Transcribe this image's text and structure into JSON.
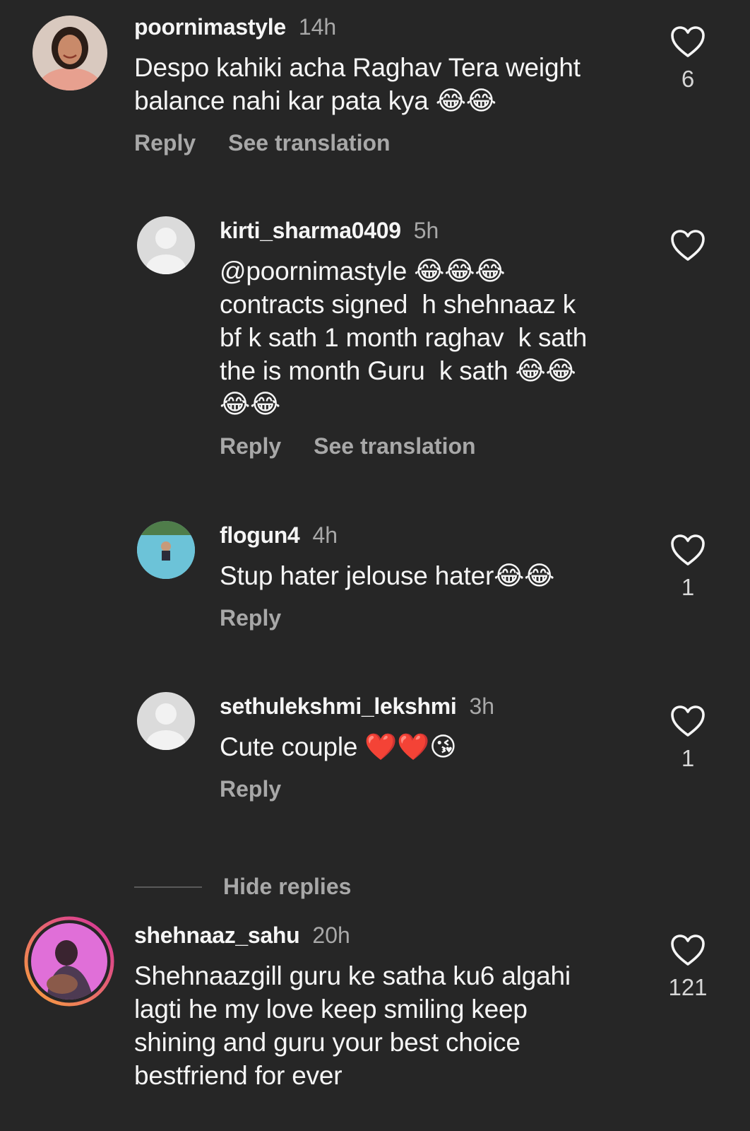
{
  "colors": {
    "background": "#262626",
    "primary_text": "#f5f5f5",
    "secondary_text": "#a8a8a8",
    "story_ring_start": "#f9a23a",
    "story_ring_end": "#d52f9e"
  },
  "icons": {
    "like": "heart-outline-icon"
  },
  "comments": [
    {
      "username": "poornimastyle",
      "time": "14h",
      "text": "Despo kahiki acha Raghav Tera weight\nbalance nahi kar pata kya 😂😂",
      "reply_label": "Reply",
      "translate_label": "See translation",
      "like_count": "6"
    },
    {
      "username": "kirti_sharma0409",
      "time": "5h",
      "text": "@poornimastyle 😂😂😂\ncontracts signed  h shehnaaz k\nbf k sath 1 month raghav  k sath\nthe is month Guru  k sath 😂😂\n😂😂",
      "reply_label": "Reply",
      "translate_label": "See translation",
      "like_count": ""
    },
    {
      "username": "flogun4",
      "time": "4h",
      "text": "Stup hater jelouse hater😂😂",
      "reply_label": "Reply",
      "like_count": "1"
    },
    {
      "username": "sethulekshmi_lekshmi",
      "time": "3h",
      "text": "Cute couple ❤️❤️😘",
      "reply_label": "Reply",
      "like_count": "1"
    },
    {
      "username": "shehnaaz_sahu",
      "time": "20h",
      "text": "Shehnaazgill guru ke satha ku6 algahi\nlagti he my love keep smiling keep\nshining and guru your best choice\nbestfriend for ever",
      "like_count": "121"
    }
  ],
  "hide_replies_label": "Hide replies"
}
